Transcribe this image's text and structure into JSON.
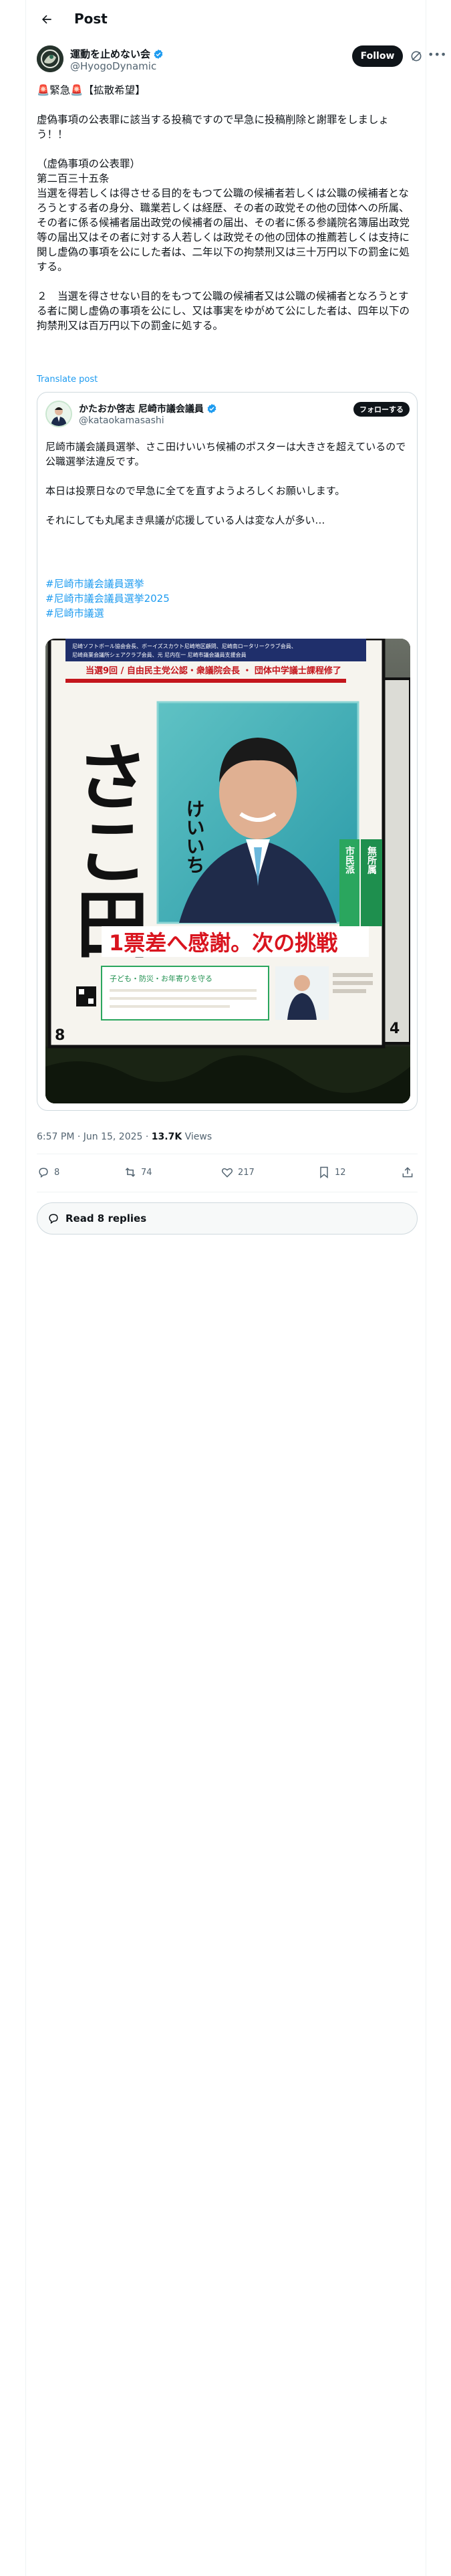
{
  "header": {
    "title": "Post"
  },
  "author": {
    "name": "運動を止めない会",
    "handle": "@HyogoDynamic",
    "follow_label": "Follow"
  },
  "tweet": {
    "text": "🚨緊急🚨【拡散希望】\n\n虚偽事項の公表罪に該当する投稿ですので早急に投稿削除と謝罪をしましょう！！\n\n（虚偽事項の公表罪）\n第二百三十五条\n当選を得若しくは得させる目的をもつて公職の候補者若しくは公職の候補者となろうとする者の身分、職業若しくは経歴、その者の政党その他の団体への所属、その者に係る候補者届出政党の候補者の届出、その者に係る参議院名簿届出政党等の届出又はその者に対する人若しくは政党その他の団体の推薦若しくは支持に関し虚偽の事項を公にした者は、二年以下の拘禁刑又は三十万円以下の罰金に処する。\n\n２　当選を得させない目的をもつて公職の候補者又は公職の候補者となろうとする者に関し虚偽の事項を公にし、又は事実をゆがめて公にした者は、四年以下の拘禁刑又は百万円以下の罰金に処する。",
    "translate_label": "Translate post"
  },
  "quote": {
    "name": "かたおか啓志 尼崎市議会議員",
    "handle": "@kataokamasashi",
    "follow_label": "フォローする",
    "text": "尼崎市議会議員選挙、さこ田けいいち候補のポスターは大きさを超えているので公職選挙法違反です。\n\n本日は投票日なので早急に全てを直すようよろしくお願いします。\n\nそれにしても丸尾まき県議が応援している人は変な人が多い…",
    "hashtags": [
      "#尼崎市議会議員選挙",
      "#尼崎市議会議員選挙2025",
      "#尼崎市議選"
    ]
  },
  "poster": {
    "banner_lines": [
      "尼崎ソフトボール協会会長、ボーイズスカウト尼崎地区顧問、尼崎南ロータリークラブ会員、",
      "尼崎商業会議所シェアクラブ会員、元 尼内在一 尼崎市議会議員支援会員"
    ],
    "headline": "当選9回 / 自由民主党公認・衆議院会長 ・ 団体中学議士課程修了",
    "name_big": "さこ田",
    "name_small": "けいいち",
    "slogan": "1票差へ感謝。次の挑戦",
    "tag1": "無所属",
    "tag2": "市民派",
    "number_left": "8",
    "number_right": "4",
    "note": "子ども・防災・お年寄りを守る"
  },
  "meta": {
    "time": "6:57 PM · Jun 15, 2025 · ",
    "views": "13.7K",
    "views_label": " Views"
  },
  "actions": {
    "replies": "8",
    "reposts": "74",
    "likes": "217",
    "bookmarks": "12"
  },
  "read_replies": "Read 8 replies",
  "colors": {
    "accent": "#1d9bf0",
    "verified": "#1d9bf0",
    "slogan_red": "#d9141e",
    "poster_green": "#1e8f4e"
  }
}
